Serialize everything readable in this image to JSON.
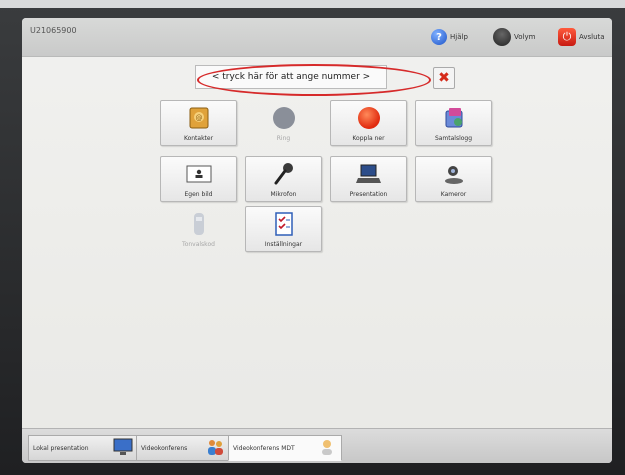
{
  "header": {
    "system_id": "U21065900",
    "help_label": "Hjälp",
    "volume_label": "Volym",
    "exit_label": "Avsluta"
  },
  "dial": {
    "number_prompt": "< tryck här för att ange nummer >",
    "clear_icon": "red-x-icon"
  },
  "tiles": [
    {
      "label": "Kontakter",
      "icon": "contacts-book-icon",
      "enabled": true
    },
    {
      "label": "Ring",
      "icon": "gray-circle-icon",
      "enabled": false
    },
    {
      "label": "Koppla ner",
      "icon": "red-circle-icon",
      "enabled": true
    },
    {
      "label": "Samtalslogg",
      "icon": "call-log-icon",
      "enabled": true
    },
    {
      "label": "Egen bild",
      "icon": "self-view-icon",
      "enabled": true
    },
    {
      "label": "Mikrofon",
      "icon": "microphone-icon",
      "enabled": true
    },
    {
      "label": "Presentation",
      "icon": "laptop-icon",
      "enabled": true
    },
    {
      "label": "Kameror",
      "icon": "camera-icon",
      "enabled": true
    },
    {
      "label": "Tonvalskod",
      "icon": "phone-keypad-icon",
      "enabled": false
    },
    {
      "label": "Inställningar",
      "icon": "checklist-icon",
      "enabled": true
    }
  ],
  "bottom_tabs": [
    {
      "label": "Lokal presentation",
      "icon": "monitor-icon"
    },
    {
      "label": "Videokonferens",
      "icon": "people-icon"
    },
    {
      "label": "Videokonferens MDT",
      "icon": "person-icon"
    }
  ],
  "colors": {
    "accent_red": "#d62a2a",
    "help_blue": "#1d54c8"
  }
}
